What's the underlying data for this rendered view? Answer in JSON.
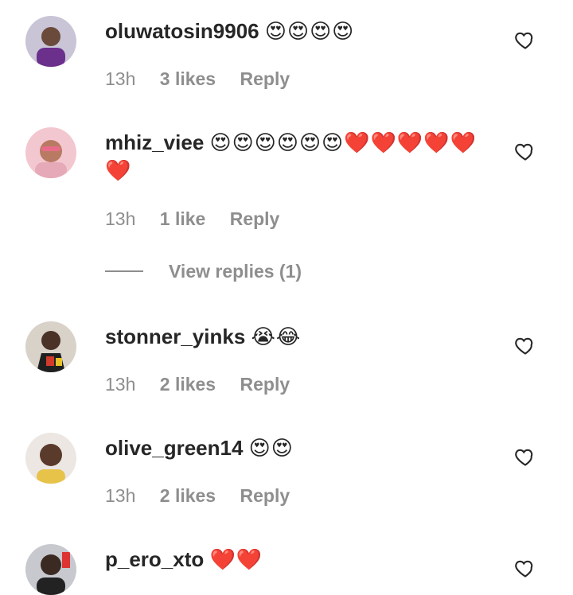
{
  "comments": [
    {
      "username": "oluwatosin9906",
      "body": "😍😍😍😍",
      "time": "13h",
      "likes": "3 likes",
      "reply": "Reply"
    },
    {
      "username": "mhiz_viee",
      "body": "😍😍😍😍😍😍❤️❤️❤️❤️❤️❤️",
      "time": "13h",
      "likes": "1 like",
      "reply": "Reply",
      "view_replies": "View replies (1)"
    },
    {
      "username": "stonner_yinks",
      "body": "😭😂",
      "time": "13h",
      "likes": "2 likes",
      "reply": "Reply"
    },
    {
      "username": "olive_green14",
      "body": "😍😍",
      "time": "13h",
      "likes": "2 likes",
      "reply": "Reply"
    },
    {
      "username": "p_ero_xto",
      "body": "❤️❤️"
    }
  ],
  "icons": {
    "like": "heart-outline-icon"
  },
  "colors": {
    "text": "#262626",
    "meta": "#8e8e8e",
    "background": "#ffffff"
  }
}
